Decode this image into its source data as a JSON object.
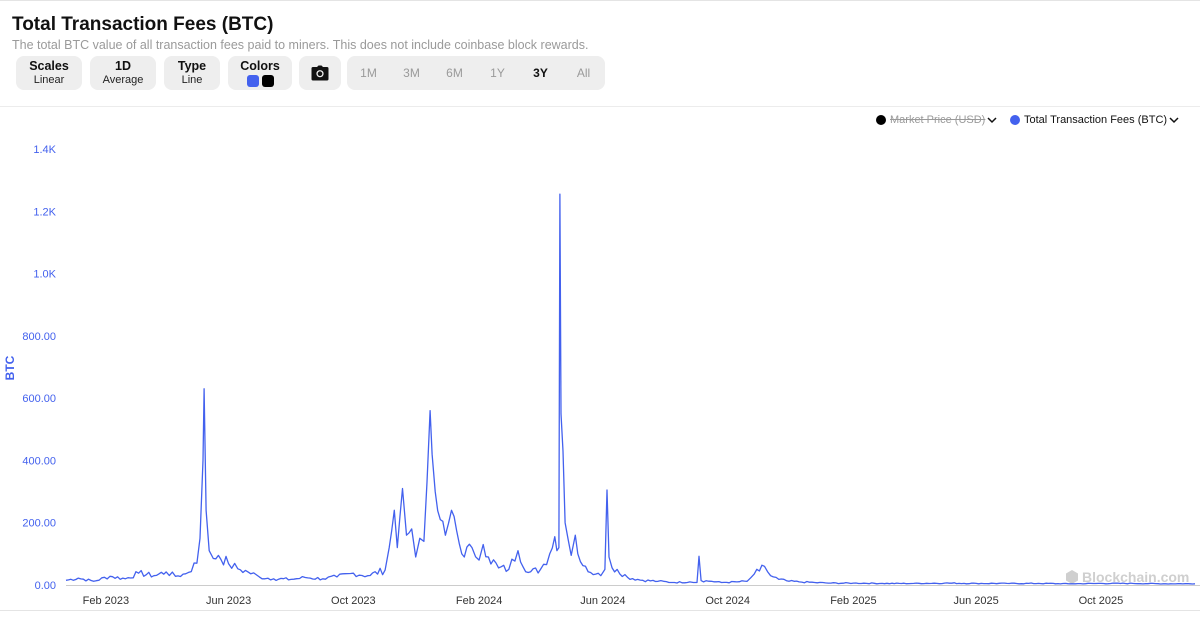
{
  "header": {
    "title": "Total Transaction Fees (BTC)",
    "subtitle": "The total BTC value of all transaction fees paid to miners. This does not include coinbase block rewards."
  },
  "controls": {
    "scales": {
      "label": "Scales",
      "value": "Linear"
    },
    "period": {
      "label": "1D",
      "value": "Average"
    },
    "type": {
      "label": "Type",
      "value": "Line"
    },
    "colors": {
      "label": "Colors",
      "series_color": "#4361ee",
      "secondary_color": "#000000"
    },
    "camera_icon": "camera-icon"
  },
  "ranges": [
    "1M",
    "3M",
    "6M",
    "1Y",
    "3Y",
    "All"
  ],
  "active_range": "3Y",
  "legend": [
    {
      "name": "Market Price (USD)",
      "color": "#000000",
      "hidden": true
    },
    {
      "name": "Total Transaction Fees (BTC)",
      "color": "#4361ee",
      "hidden": false
    }
  ],
  "watermark": "Blockchain.com",
  "chart_data": {
    "type": "line",
    "title": "Total Transaction Fees (BTC)",
    "ylabel": "BTC",
    "ylim": [
      0,
      1400
    ],
    "yticks": [
      0,
      200,
      400,
      600,
      800,
      1000,
      1200,
      1400
    ],
    "ytick_labels": [
      "0.00",
      "200.00",
      "400.00",
      "600.00",
      "800.00",
      "1.0K",
      "1.2K",
      "1.4K"
    ],
    "xlim": [
      "2022-12-24",
      "2026-01-01"
    ],
    "xticks": [
      "2023-02-01",
      "2023-06-01",
      "2023-10-01",
      "2024-02-01",
      "2024-06-01",
      "2024-10-01",
      "2025-02-01",
      "2025-06-01",
      "2025-10-01"
    ],
    "xtick_labels": [
      "Feb 2023",
      "Jun 2023",
      "Oct 2023",
      "Feb 2024",
      "Jun 2024",
      "Oct 2024",
      "Feb 2025",
      "Jun 2025",
      "Oct 2025"
    ],
    "grid": false,
    "legend_position": "top-right",
    "series": [
      {
        "name": "Total Transaction Fees (BTC)",
        "color": "#4361ee",
        "x": [
          "2022-12-24",
          "2023-01-05",
          "2023-01-20",
          "2023-02-05",
          "2023-02-20",
          "2023-03-05",
          "2023-03-20",
          "2023-04-01",
          "2023-04-10",
          "2023-04-20",
          "2023-05-01",
          "2023-05-04",
          "2023-05-07",
          "2023-05-08",
          "2023-05-10",
          "2023-05-13",
          "2023-05-17",
          "2023-05-22",
          "2023-06-01",
          "2023-06-10",
          "2023-06-20",
          "2023-07-01",
          "2023-07-15",
          "2023-08-01",
          "2023-08-15",
          "2023-09-01",
          "2023-09-15",
          "2023-10-01",
          "2023-10-15",
          "2023-11-01",
          "2023-11-05",
          "2023-11-10",
          "2023-11-13",
          "2023-11-18",
          "2023-11-22",
          "2023-11-27",
          "2023-12-01",
          "2023-12-05",
          "2023-12-09",
          "2023-12-12",
          "2023-12-15",
          "2023-12-17",
          "2023-12-20",
          "2023-12-25",
          "2023-12-30",
          "2024-01-05",
          "2024-01-15",
          "2024-01-25",
          "2024-02-01",
          "2024-02-05",
          "2024-02-10",
          "2024-02-20",
          "2024-03-01",
          "2024-03-10",
          "2024-03-20",
          "2024-04-01",
          "2024-04-10",
          "2024-04-15",
          "2024-04-17",
          "2024-04-19",
          "2024-04-20",
          "2024-04-21",
          "2024-04-23",
          "2024-04-25",
          "2024-05-01",
          "2024-05-05",
          "2024-05-10",
          "2024-05-15",
          "2024-05-20",
          "2024-05-25",
          "2024-05-30",
          "2024-06-03",
          "2024-06-05",
          "2024-06-07",
          "2024-06-10",
          "2024-06-15",
          "2024-06-25",
          "2024-07-10",
          "2024-07-25",
          "2024-08-10",
          "2024-08-25",
          "2024-09-01",
          "2024-09-03",
          "2024-09-05",
          "2024-09-15",
          "2024-09-25",
          "2024-10-10",
          "2024-10-20",
          "2024-10-27",
          "2024-11-01",
          "2024-11-06",
          "2024-11-12",
          "2024-11-20",
          "2024-11-30",
          "2024-12-10",
          "2024-12-25",
          "2025-01-10",
          "2025-02-01",
          "2025-03-01",
          "2025-04-01",
          "2025-05-01",
          "2025-06-01",
          "2025-07-01",
          "2025-08-01",
          "2025-09-01",
          "2025-10-01",
          "2025-11-01",
          "2025-12-01",
          "2026-01-01"
        ],
        "y": [
          15,
          22,
          12,
          28,
          20,
          38,
          30,
          42,
          28,
          36,
          70,
          150,
          400,
          630,
          240,
          110,
          85,
          95,
          68,
          52,
          42,
          26,
          20,
          18,
          24,
          20,
          26,
          38,
          30,
          48,
          120,
          240,
          120,
          310,
          160,
          180,
          90,
          150,
          140,
          330,
          560,
          420,
          300,
          210,
          160,
          240,
          100,
          120,
          80,
          130,
          90,
          55,
          50,
          110,
          40,
          50,
          100,
          155,
          110,
          120,
          1255,
          550,
          430,
          200,
          95,
          160,
          75,
          60,
          40,
          35,
          30,
          50,
          305,
          90,
          55,
          50,
          25,
          15,
          12,
          8,
          10,
          8,
          92,
          14,
          12,
          8,
          10,
          12,
          35,
          45,
          60,
          30,
          18,
          12,
          10,
          8,
          6,
          6,
          5,
          5,
          6,
          5,
          5,
          5,
          4,
          5,
          5,
          4,
          4
        ]
      }
    ]
  }
}
